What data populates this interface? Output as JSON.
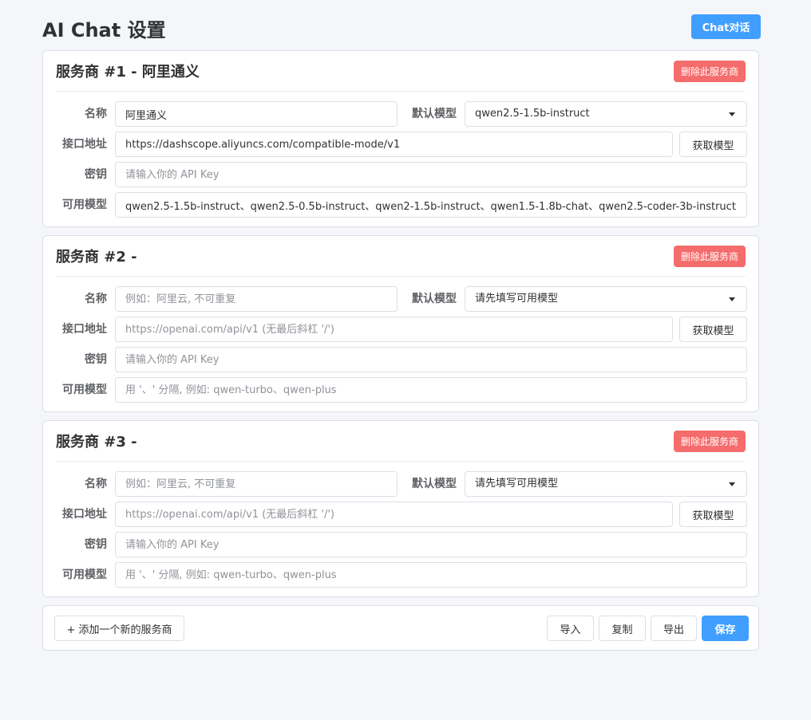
{
  "header": {
    "title": "AI Chat 设置",
    "chat_button": "Chat对话"
  },
  "labels": {
    "name": "名称",
    "default_model": "默认模型",
    "endpoint": "接口地址",
    "key": "密钥",
    "models": "可用模型",
    "delete_button": "删除此服务商",
    "fetch_button": "获取模型"
  },
  "providers": [
    {
      "title": "服务商 #1 - 阿里通义",
      "name_value": "阿里通义",
      "name_placeholder": "例如：阿里云, 不可重复",
      "default_model": "qwen2.5-1.5b-instruct",
      "endpoint_value": "https://dashscope.aliyuncs.com/compatible-mode/v1",
      "endpoint_placeholder": "https://openai.com/api/v1 (无最后斜杠 '/')",
      "key_value": "",
      "key_placeholder": "请输入你的 API Key",
      "models_value": "qwen2.5-1.5b-instruct、qwen2.5-0.5b-instruct、qwen2-1.5b-instruct、qwen1.5-1.8b-chat、qwen2.5-coder-3b-instruct",
      "models_placeholder": "用 '、' 分隔, 例如: qwen-turbo、qwen-plus"
    },
    {
      "title": "服务商 #2 -",
      "name_value": "",
      "name_placeholder": "例如：阿里云, 不可重复",
      "default_model": "请先填写可用模型",
      "endpoint_value": "",
      "endpoint_placeholder": "https://openai.com/api/v1 (无最后斜杠 '/')",
      "key_value": "",
      "key_placeholder": "请输入你的 API Key",
      "models_value": "",
      "models_placeholder": "用 '、' 分隔, 例如: qwen-turbo、qwen-plus"
    },
    {
      "title": "服务商 #3 -",
      "name_value": "",
      "name_placeholder": "例如：阿里云, 不可重复",
      "default_model": "请先填写可用模型",
      "endpoint_value": "",
      "endpoint_placeholder": "https://openai.com/api/v1 (无最后斜杠 '/')",
      "key_value": "",
      "key_placeholder": "请输入你的 API Key",
      "models_value": "",
      "models_placeholder": "用 '、' 分隔, 例如: qwen-turbo、qwen-plus"
    }
  ],
  "footer": {
    "add_button": "+ 添加一个新的服务商",
    "import_button": "导入",
    "copy_button": "复制",
    "export_button": "导出",
    "save_button": "保存"
  },
  "colors": {
    "primary": "#409eff",
    "danger": "#f56c6c",
    "background": "#f5f6fa"
  }
}
